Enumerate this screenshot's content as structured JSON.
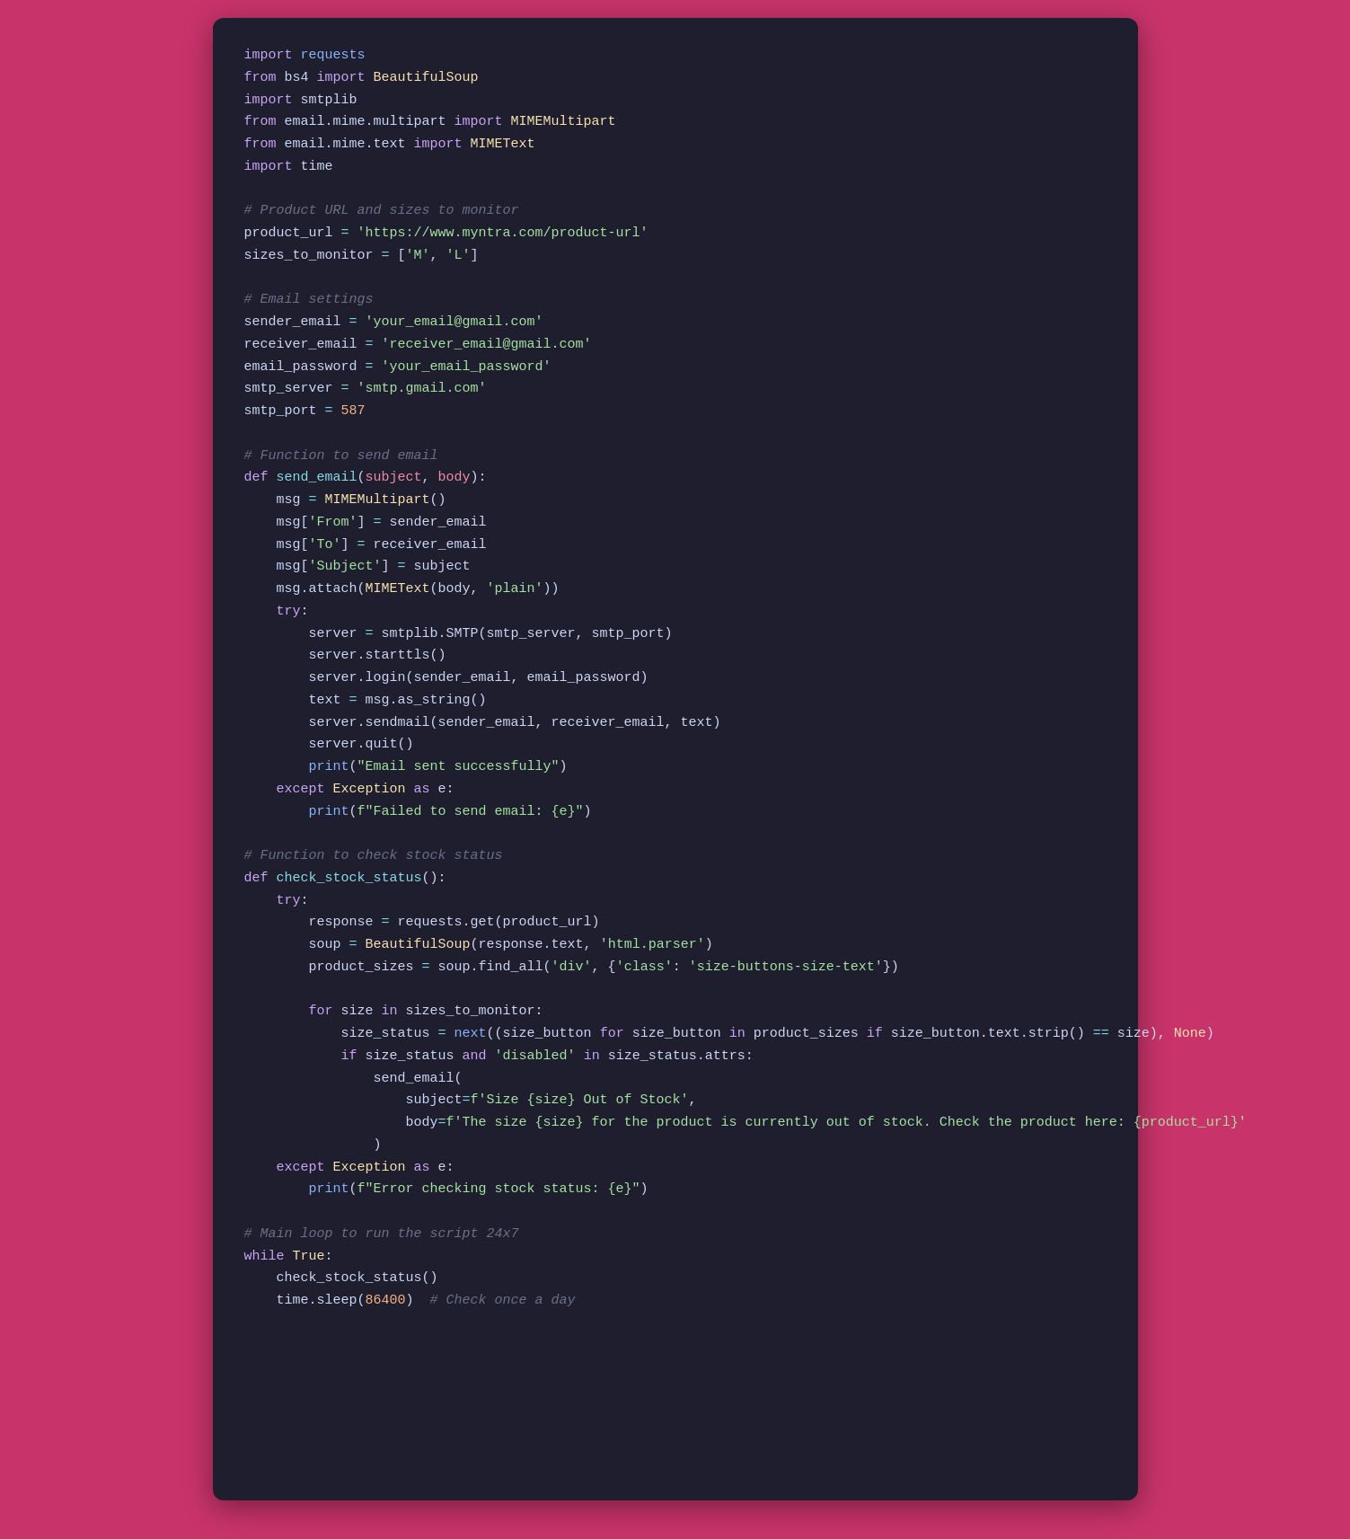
{
  "window": {
    "background": "#c8336a",
    "code_background": "#1e1e2e"
  },
  "code": {
    "lines": "Python code for monitoring product stock status on Myntra"
  }
}
